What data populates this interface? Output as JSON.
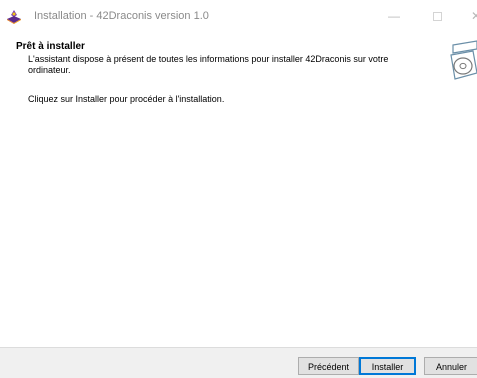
{
  "window": {
    "title": "Installation - 42Draconis version 1.0",
    "minimize_glyph": "—",
    "close_glyph": "✕"
  },
  "header": {
    "title": "Prêt à installer",
    "description": "L'assistant dispose à présent de toutes les informations pour installer 42Draconis sur votre ordinateur."
  },
  "content": {
    "instruction": "Cliquez sur Installer pour procéder à l'installation."
  },
  "buttons": {
    "back": "Précédent",
    "install": "Installer",
    "cancel": "Annuler"
  },
  "colors": {
    "accent": "#0078d7",
    "button_face": "#e1e1e1",
    "bottom_bar": "#f0f0f0"
  },
  "icons": {
    "app": "installer-app-icon",
    "wizard": "disc-box-icon"
  }
}
